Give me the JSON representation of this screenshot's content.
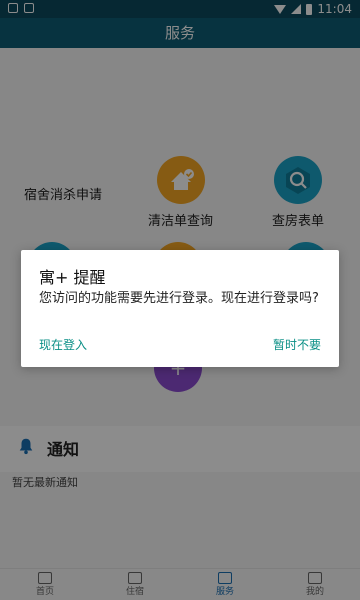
{
  "status_bar": {
    "time": "11:04"
  },
  "app_bar": {
    "title": "服务"
  },
  "services": [
    {
      "label": "宿舍消杀申请"
    },
    {
      "label": "清洁单查询",
      "icon": "house-check-icon",
      "color": "#f5a623"
    },
    {
      "label": "查房表单",
      "icon": "search-icon",
      "color": "#1ba3c6"
    },
    {
      "label": "",
      "icon": "plus-icon",
      "color": "#8a4bd0"
    }
  ],
  "notice": {
    "title": "通知",
    "empty_text": "暂无最新通知"
  },
  "bottom_nav": {
    "items": [
      {
        "label": "首页"
      },
      {
        "label": "住宿"
      },
      {
        "label": "服务"
      },
      {
        "label": "我的"
      }
    ]
  },
  "dialog": {
    "title": "寓+ 提醒",
    "message": "您访问的功能需要先进行登录。现在进行登录吗?",
    "left_button": "现在登入",
    "right_button": "暂时不要"
  },
  "colors": {
    "status_bar": "#0b4a5d",
    "app_bar": "#0d5d75",
    "accent_teal": "#0a8f86",
    "active_nav": "#1b6fb3"
  }
}
